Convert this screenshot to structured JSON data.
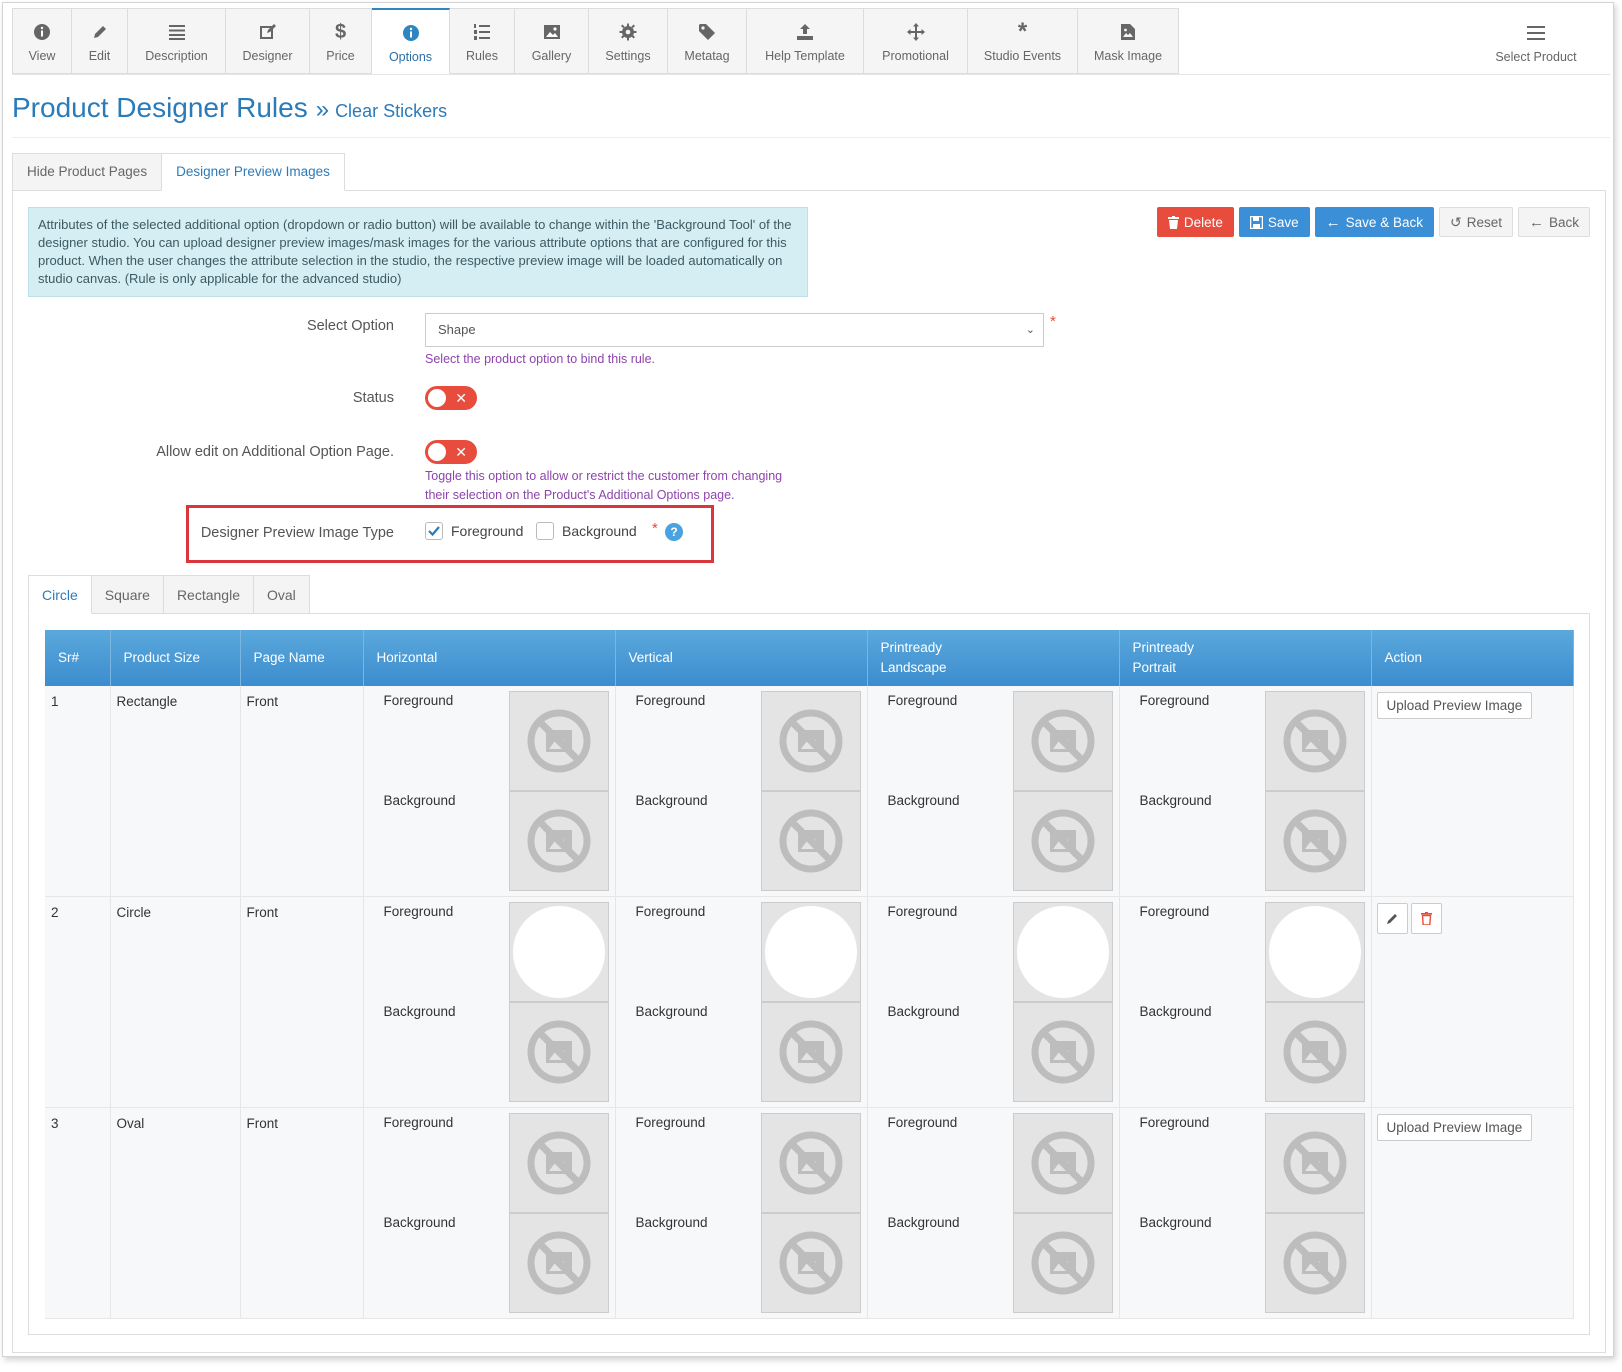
{
  "toolbar": {
    "items": [
      {
        "label": "View",
        "icon": "info-circle-icon"
      },
      {
        "label": "Edit",
        "icon": "pencil-icon"
      },
      {
        "label": "Description",
        "icon": "list-icon"
      },
      {
        "label": "Designer",
        "icon": "edit-square-icon"
      },
      {
        "label": "Price",
        "icon": "dollar-icon"
      },
      {
        "label": "Options",
        "icon": "info-circle-icon",
        "active": true
      },
      {
        "label": "Rules",
        "icon": "ordered-list-icon"
      },
      {
        "label": "Gallery",
        "icon": "image-icon"
      },
      {
        "label": "Settings",
        "icon": "gear-icon"
      },
      {
        "label": "Metatag",
        "icon": "tag-icon"
      },
      {
        "label": "Help Template",
        "icon": "upload-icon"
      },
      {
        "label": "Promotional",
        "icon": "move-icon"
      },
      {
        "label": "Studio Events",
        "icon": "asterisk-icon"
      },
      {
        "label": "Mask Image",
        "icon": "file-image-icon"
      }
    ],
    "right": {
      "label": "Select Product",
      "icon": "hamburger-icon"
    }
  },
  "header": {
    "title": "Product Designer Rules",
    "separator": "»",
    "subtitle": "Clear Stickers"
  },
  "top_tabs": [
    {
      "label": "Hide Product Pages",
      "active": false
    },
    {
      "label": "Designer Preview Images",
      "active": true
    }
  ],
  "info_text": "Attributes of the selected additional option (dropdown or radio button) will be available to change within the 'Background Tool' of the designer studio. You can upload designer preview images/mask images for the various attribute options that are configured for this product. When the user changes the attribute selection in the studio, the respective preview image will be loaded automatically on studio canvas. (Rule is only applicable for the advanced studio)",
  "buttons": {
    "delete": "Delete",
    "save": "Save",
    "save_back": "Save & Back",
    "reset": "Reset",
    "back": "Back"
  },
  "form": {
    "select_option_label": "Select Option",
    "select_option_value": "Shape",
    "select_option_help": "Select the product option to bind this rule.",
    "status_label": "Status",
    "status_on": false,
    "allow_edit_label": "Allow edit on Additional Option Page.",
    "allow_edit_on": false,
    "allow_edit_help_1": "Toggle this option to allow or restrict the customer from changing",
    "allow_edit_help_2": "their selection on the Product's Additional Options page.",
    "preview_type_label": "Designer Preview Image Type",
    "foreground_label": "Foreground",
    "foreground_checked": true,
    "background_label": "Background",
    "background_checked": false,
    "required_mark": "*",
    "help_mark": "?"
  },
  "shape_tabs": [
    "Circle",
    "Square",
    "Rectangle",
    "Oval"
  ],
  "table": {
    "headers": [
      "Sr#",
      "Product Size",
      "Page Name",
      "Horizontal",
      "Vertical",
      "Printready Landscape",
      "Printready Portrait",
      "Action"
    ],
    "fg_label": "Foreground",
    "bg_label": "Background",
    "rows": [
      {
        "sr": "1",
        "size": "Rectangle",
        "page": "Front",
        "has_fg_image": false,
        "action": "Upload Preview Image"
      },
      {
        "sr": "2",
        "size": "Circle",
        "page": "Front",
        "has_fg_image": true,
        "action": ""
      },
      {
        "sr": "3",
        "size": "Oval",
        "page": "Front",
        "has_fg_image": false,
        "action": "Upload Preview Image"
      }
    ]
  },
  "colors": {
    "accent": "#2b7bb9",
    "danger": "#e74c3c",
    "primary": "#3b8fd6",
    "info_bg": "#d5eef3",
    "help_text": "#8e44ad",
    "header_blue": "#4a9ad6"
  }
}
